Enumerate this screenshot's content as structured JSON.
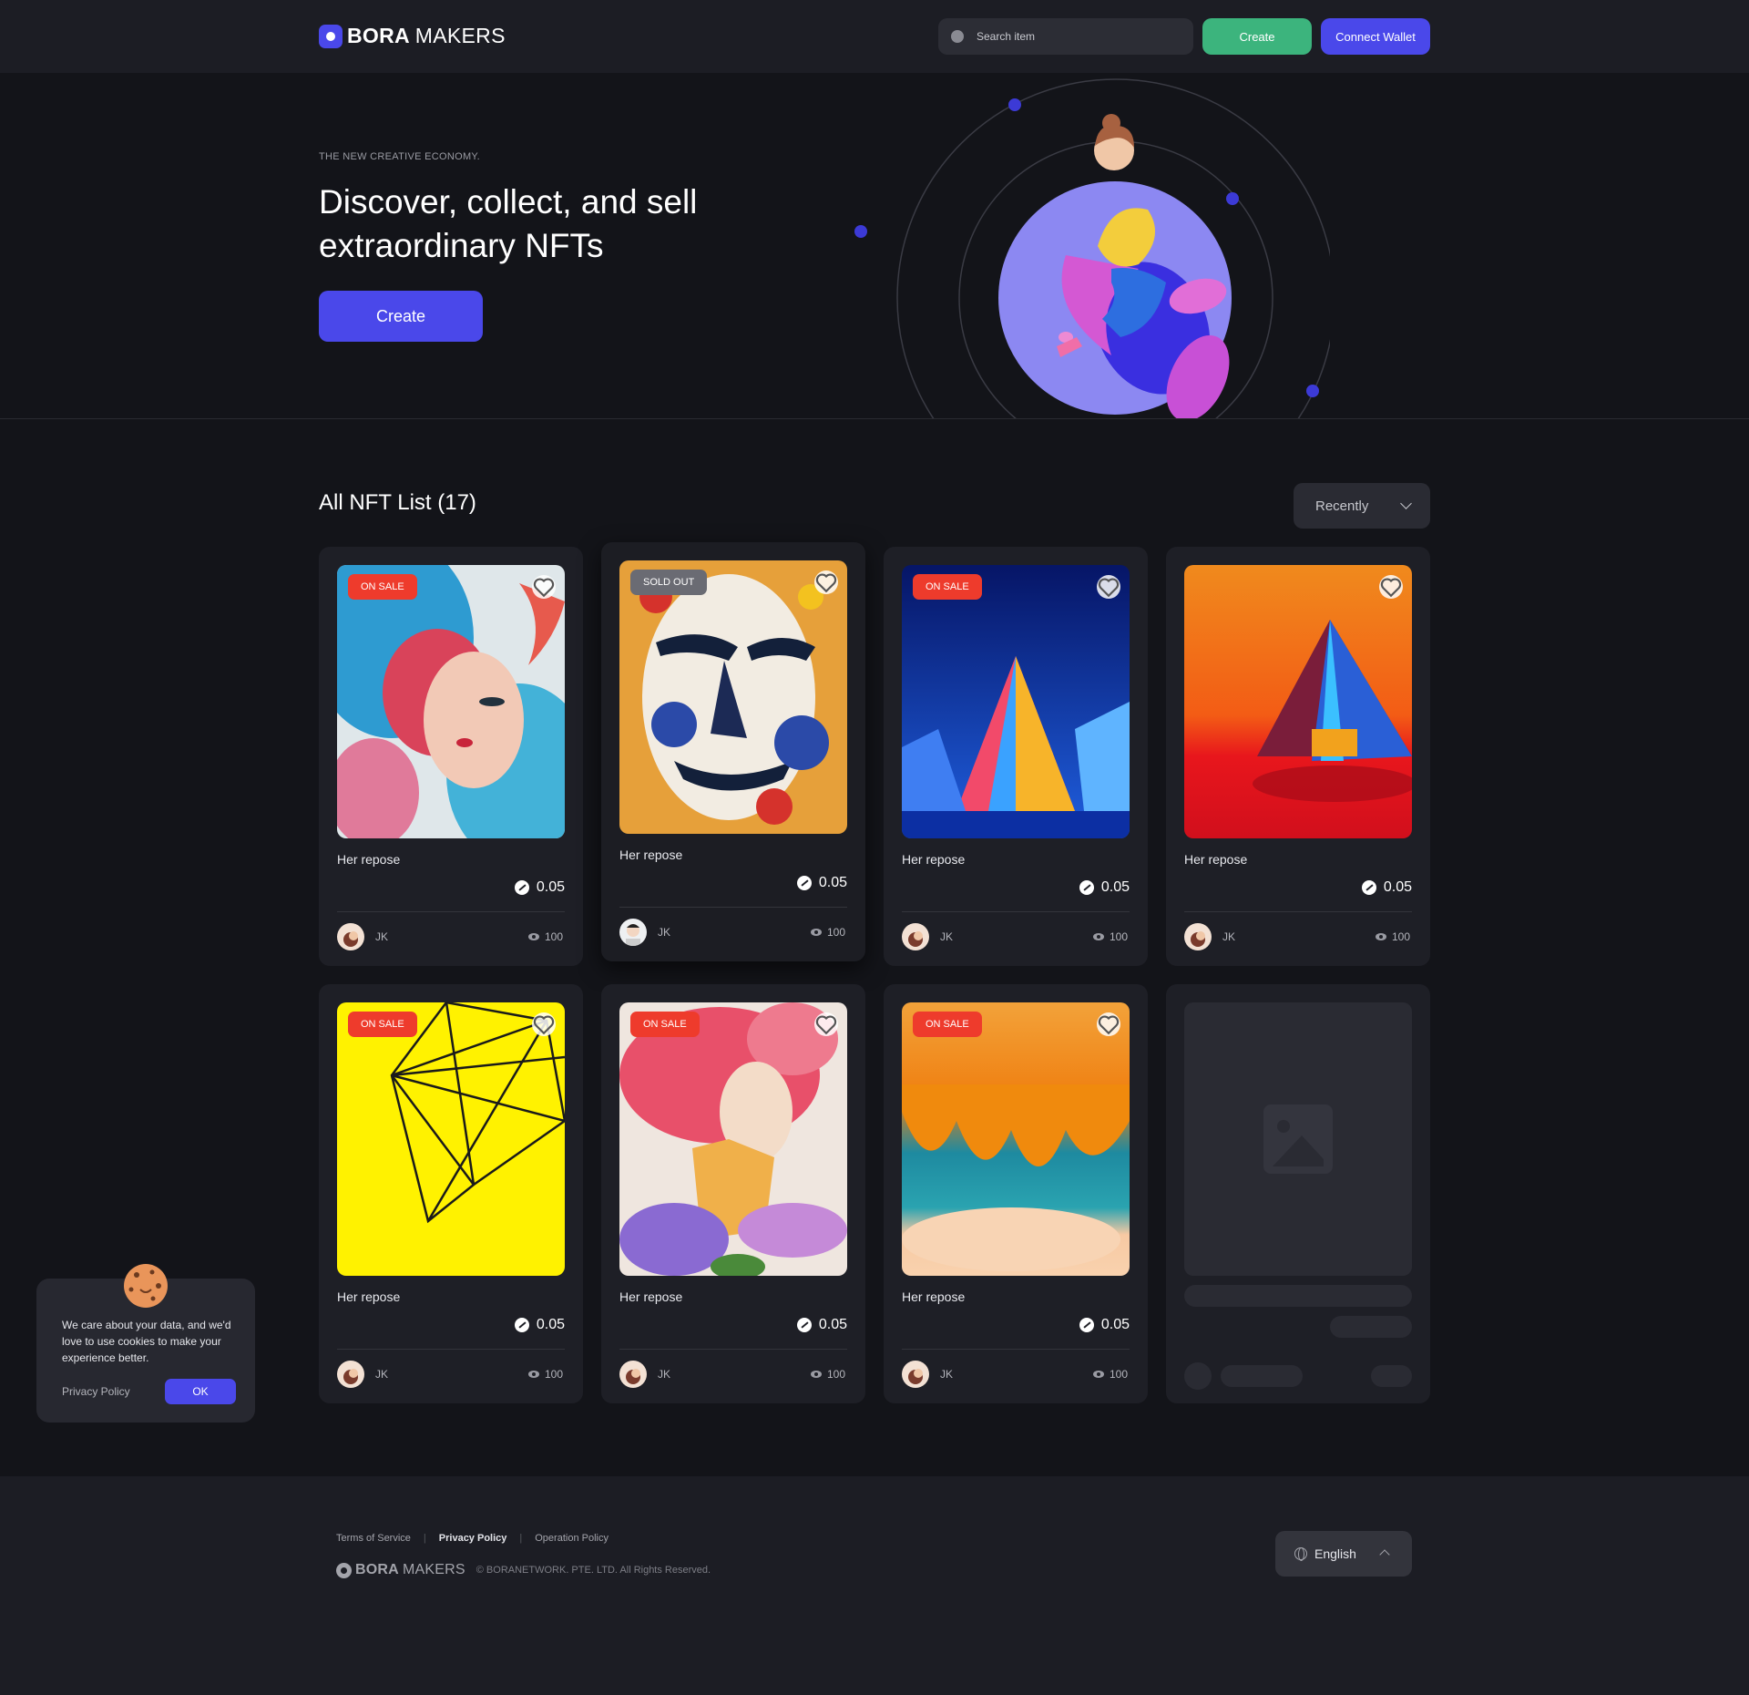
{
  "header": {
    "brand_bold": "BORA",
    "brand_thin": "MAKERS",
    "search_placeholder": "Search item",
    "create_label": "Create",
    "wallet_label": "Connect Wallet"
  },
  "hero": {
    "eyebrow": "THE NEW CREATIVE ECONOMY.",
    "headline": "Discover, collect, and sell extraordinary NFTs",
    "cta_label": "Create"
  },
  "list": {
    "title": "All NFT List (17)",
    "sort_value": "Recently",
    "cards": [
      {
        "status": "ON SALE",
        "name": "Her repose",
        "price": "0.05",
        "owner": "JK",
        "views": "100"
      },
      {
        "status": "SOLD OUT",
        "name": "Her repose",
        "price": "0.05",
        "owner": "JK",
        "views": "100"
      },
      {
        "status": "ON SALE",
        "name": "Her repose",
        "price": "0.05",
        "owner": "JK",
        "views": "100"
      },
      {
        "status": "",
        "name": "Her repose",
        "price": "0.05",
        "owner": "JK",
        "views": "100"
      },
      {
        "status": "ON SALE",
        "name": "Her repose",
        "price": "0.05",
        "owner": "JK",
        "views": "100"
      },
      {
        "status": "ON SALE",
        "name": "Her repose",
        "price": "0.05",
        "owner": "JK",
        "views": "100"
      },
      {
        "status": "ON SALE",
        "name": "Her repose",
        "price": "0.05",
        "owner": "JK",
        "views": "100"
      }
    ]
  },
  "cookie": {
    "message": "We care about your data, and we'd love to use cookies to make your experience better.",
    "privacy_label": "Privacy Policy",
    "ok_label": "OK"
  },
  "footer": {
    "links": [
      "Terms of Service",
      "Privacy Policy",
      "Operation Policy"
    ],
    "brand_bold": "BORA",
    "brand_thin": "MAKERS",
    "copyright": "© BORANETWORK. PTE. LTD. All Rights Reserved.",
    "language": "English"
  },
  "colors": {
    "accent": "#4a48ea",
    "create_green": "#3cb47d",
    "on_sale": "#ee3b2c",
    "sold_out": "#6a6b73",
    "background": "#131419"
  },
  "icons": [
    "search-icon",
    "heart-icon",
    "bora-token-icon",
    "eye-icon",
    "globe-icon",
    "chevron-down-icon",
    "chevron-up-icon",
    "cookie-icon",
    "image-placeholder-icon"
  ]
}
